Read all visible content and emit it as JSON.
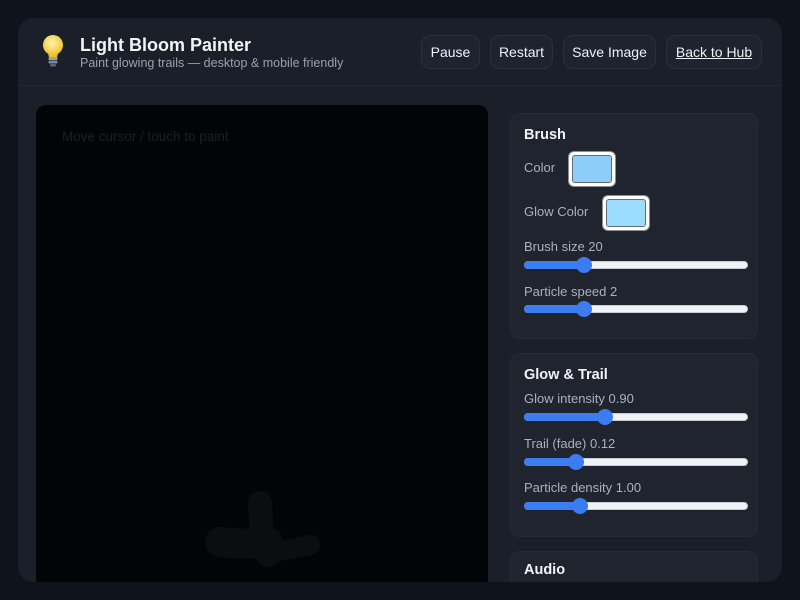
{
  "header": {
    "title": "Light Bloom Painter",
    "subtitle": "Paint glowing trails — desktop & mobile friendly",
    "buttons": {
      "pause": "Pause",
      "restart": "Restart",
      "save": "Save Image",
      "back": "Back to Hub"
    }
  },
  "canvas": {
    "hint": "Move cursor / touch to paint"
  },
  "brush": {
    "title": "Brush",
    "color_label": "Color",
    "color_value": "#8ecdf9",
    "glow_label": "Glow Color",
    "glow_value": "#9cdcff",
    "size_label": "Brush size 20",
    "size_fraction": 0.25,
    "speed_label": "Particle speed 2",
    "speed_fraction": 0.25
  },
  "glow": {
    "title": "Glow & Trail",
    "intensity_label": "Glow intensity 0.90",
    "intensity_fraction": 0.35,
    "trail_label": "Trail (fade) 0.12",
    "trail_fraction": 0.21,
    "density_label": "Particle density 1.00",
    "density_fraction": 0.23
  },
  "audio": {
    "title": "Audio"
  },
  "colors": {
    "accent": "#3b7cf0",
    "canvas": "#030405",
    "panel": "#20242f"
  }
}
